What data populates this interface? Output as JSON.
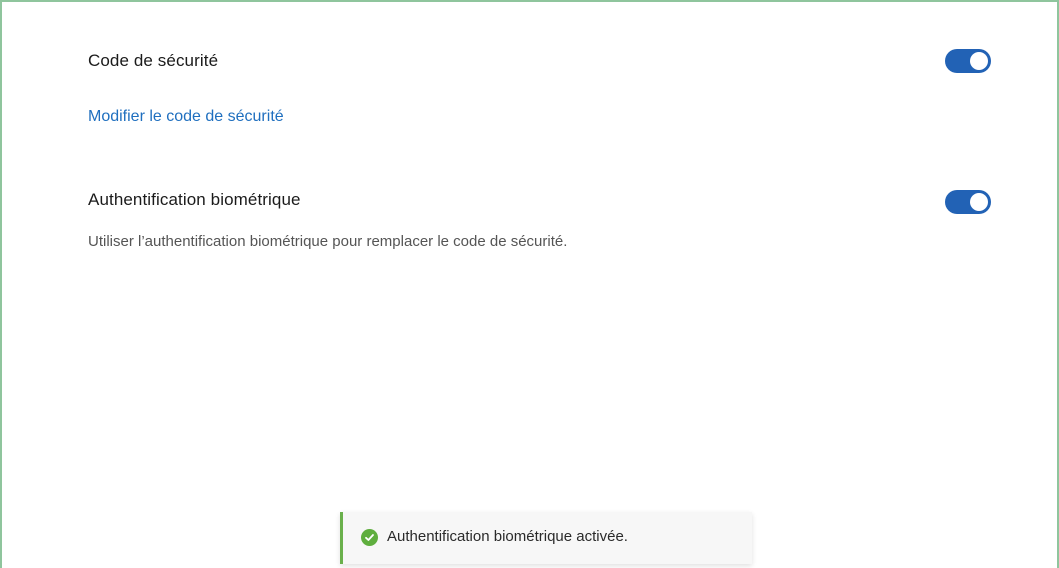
{
  "security_code": {
    "title": "Code de sécurité",
    "enabled": true,
    "modify_link": "Modifier le code de sécurité"
  },
  "biometric": {
    "title": "Authentification biométrique",
    "enabled": true,
    "description": "Utiliser l’authentification biométrique pour remplacer le code de sécurité."
  },
  "toast": {
    "message": "Authentification biométrique activée.",
    "icon": "check-circle-icon",
    "status_color": "#5fae3e"
  },
  "colors": {
    "accent": "#2262b5",
    "link": "#1f6fbf",
    "frame_border": "#8fc59d"
  }
}
